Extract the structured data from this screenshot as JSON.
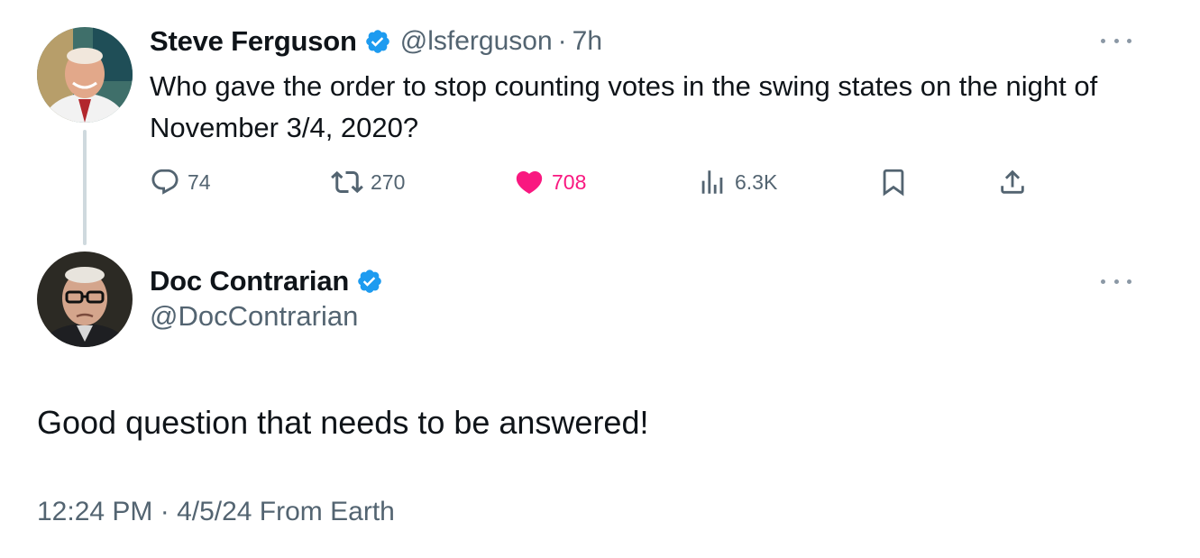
{
  "original_tweet": {
    "author_name": "Steve Ferguson",
    "handle": "@lsferguson",
    "separator": "·",
    "time_ago": "7h",
    "text": "Who gave the order to stop counting votes in the swing states on the night of November 3/4, 2020?",
    "avatar_icon": "avatar-photo-man-smiling",
    "verified_icon": "verified-badge-icon",
    "stats": {
      "replies": "74",
      "retweets": "270",
      "likes": "708",
      "views": "6.3K"
    },
    "liked": true
  },
  "reply_tweet": {
    "author_name": "Doc Contrarian",
    "handle": "@DocContrarian",
    "text": "Good question that needs to be answered!",
    "timestamp": "12:24 PM · 4/5/24 From Earth",
    "avatar_icon": "avatar-photo-elderly-man-glasses",
    "verified_icon": "verified-badge-icon"
  },
  "colors": {
    "text_primary": "#0f1419",
    "text_secondary": "#536471",
    "like_pink": "#f91880",
    "verified_blue": "#1d9bf0",
    "thread_line": "#cfd9de"
  }
}
